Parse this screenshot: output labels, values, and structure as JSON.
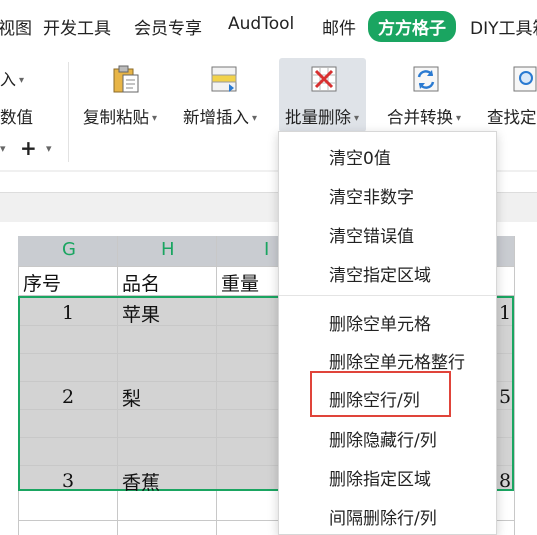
{
  "tabs": [
    "视图",
    "开发工具",
    "会员专享",
    "AudTool",
    "邮件",
    "方方格子",
    "DIY工具箱"
  ],
  "active_tab": "方方格子",
  "ribbon": {
    "left_fragment_top": "入",
    "left_fragment_mid": "数值",
    "plus_symbol": "+",
    "buttons": [
      {
        "label": "复制粘贴",
        "icon": "paste-icon"
      },
      {
        "label": "新增插入",
        "icon": "insert-icon"
      },
      {
        "label": "批量删除",
        "icon": "batch-delete-icon"
      },
      {
        "label": "合并转换",
        "icon": "merge-convert-icon"
      },
      {
        "label": "查找定位",
        "icon": "find-locate-icon"
      }
    ]
  },
  "sheet": {
    "col_headers": [
      "G",
      "H",
      "I"
    ],
    "header_row": [
      "序号",
      "品名",
      "重量"
    ],
    "rows": [
      {
        "no": "1",
        "name": "苹果",
        "edge": "1"
      },
      {
        "no": "2",
        "name": "梨",
        "edge": "5"
      },
      {
        "no": "3",
        "name": "香蕉",
        "edge": "8"
      }
    ]
  },
  "dropdown": {
    "items": [
      "清空0值",
      "清空非数字",
      "清空错误值",
      "清空指定区域",
      "删除空单元格",
      "删除空单元格整行",
      "删除空行/列",
      "删除隐藏行/列",
      "删除指定区域",
      "间隔删除行/列"
    ],
    "highlighted": "删除空行/列"
  },
  "colors": {
    "accent": "#1aa561",
    "highlight_box": "#e0443a"
  }
}
